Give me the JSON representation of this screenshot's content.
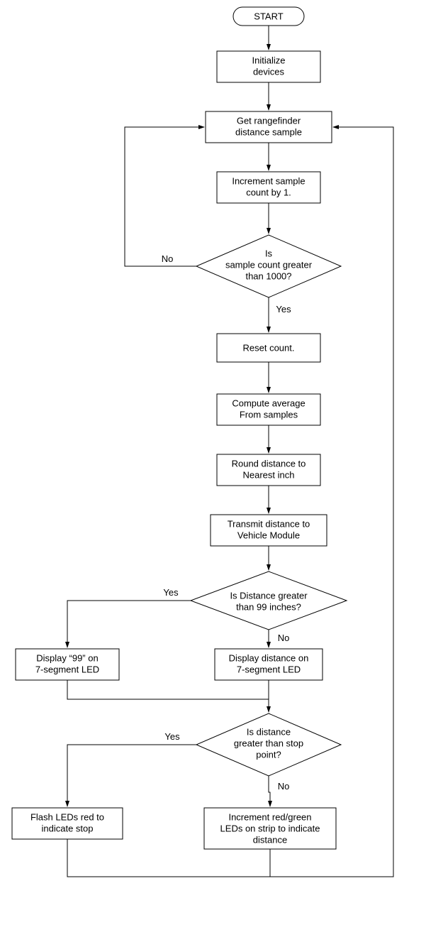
{
  "nodes": {
    "start": "START",
    "init1": "Initialize",
    "init2": "devices",
    "get1": "Get rangefinder",
    "get2": "distance sample",
    "inc1": "Increment sample",
    "inc2": "count by 1.",
    "d1a": "Is",
    "d1b": "sample count greater",
    "d1c": "than 1000?",
    "reset": "Reset count.",
    "avg1": "Compute average",
    "avg2": "From samples",
    "round1": "Round distance to",
    "round2": "Nearest inch",
    "tx1": "Transmit distance to",
    "tx2": "Vehicle Module",
    "d2a": "Is Distance greater",
    "d2b": "than 99 inches?",
    "disp99a": "Display “99” on",
    "disp99b": "7-segment LED",
    "dispa": "Display distance on",
    "dispb": "7-segment LED",
    "d3a": "Is distance",
    "d3b": "greater than stop",
    "d3c": "point?",
    "flash1": "Flash LEDs red to",
    "flash2": "indicate stop",
    "incled1": "Increment red/green",
    "incled2": "LEDs on strip to indicate",
    "incled3": "distance"
  },
  "labels": {
    "no": "No",
    "yes": "Yes"
  }
}
